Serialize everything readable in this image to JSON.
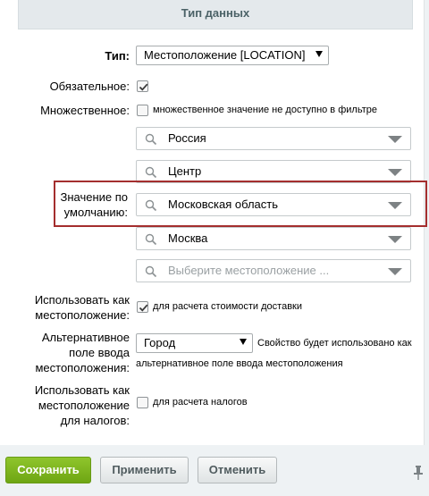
{
  "section": {
    "title": "Тип данных"
  },
  "fields": {
    "type": {
      "label": "Тип:",
      "value": "Местоположение [LOCATION]"
    },
    "required": {
      "label": "Обязательное:",
      "checked": true
    },
    "multiple": {
      "label": "Множественное:",
      "checked": false,
      "note": "множественное значение не доступно в фильтре"
    },
    "default": {
      "label_line1": "Значение по",
      "label_line2": "умолчанию:",
      "levels": [
        {
          "value": "Россия"
        },
        {
          "value": "Центр"
        },
        {
          "value": "Московская область"
        },
        {
          "value": "Москва"
        }
      ],
      "placeholder": "Выберите местоположение ..."
    },
    "use_as_location": {
      "label_line1": "Использовать как",
      "label_line2": "местоположение:",
      "checked": true,
      "note": "для расчета стоимости доставки"
    },
    "alt_field": {
      "label_line1": "Альтернативное",
      "label_line2": "поле ввода",
      "label_line3": "местоположения:",
      "value": "Город",
      "note_line1": "Свойство будет использовано как",
      "note_line2": "альтернативное поле ввода местоположения"
    },
    "tax_location": {
      "label_line1": "Использовать как",
      "label_line2": "местоположение",
      "label_line3": "для налогов:",
      "checked": false,
      "note": "для расчета налогов"
    }
  },
  "buttons": {
    "save": "Сохранить",
    "apply": "Применить",
    "cancel": "Отменить"
  },
  "colors": {
    "highlight": "#a42e2e",
    "save_button": "#7cb51e",
    "header_bg": "#e4e9ec"
  },
  "icons": [
    "search-icon",
    "dropdown-arrow-icon",
    "checkmark-icon",
    "pin-icon"
  ]
}
